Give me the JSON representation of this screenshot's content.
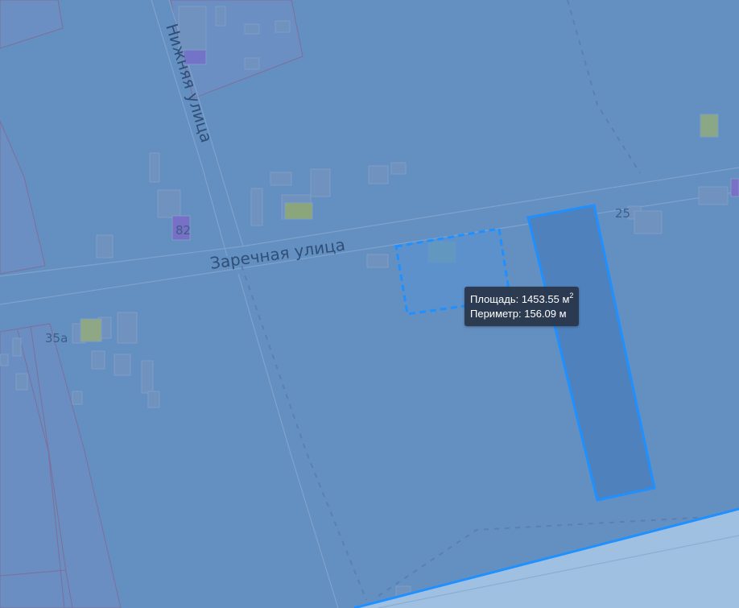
{
  "map": {
    "streets": {
      "zarechnaya": "Заречная  улица",
      "nizhnyaya": "Нижняя улица"
    },
    "house_numbers": {
      "n82": "82",
      "n35a": "35а",
      "n25": "25"
    },
    "colors": {
      "overlay": "#6490c1",
      "drawn_shape_fill": "#4f82bd",
      "drawn_shape_stroke": "#1e90ff",
      "water": "#9fc0e0"
    }
  },
  "measure_tooltip": {
    "area_label": "Площадь:",
    "area_value": "1453.55",
    "area_unit": "м",
    "area_exp": "2",
    "perimeter_label": "Периметр:",
    "perimeter_value": "156.09 м"
  }
}
